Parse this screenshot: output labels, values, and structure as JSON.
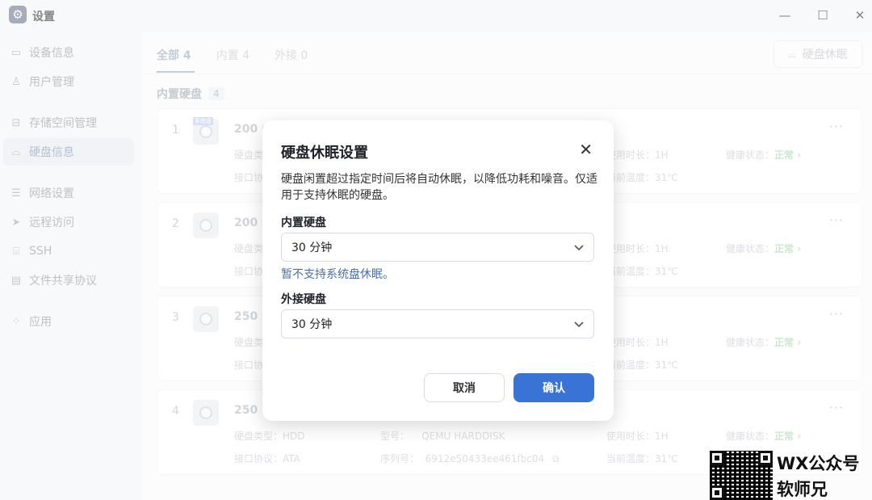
{
  "window": {
    "title": "设置",
    "minimize_glyph": "—",
    "maximize_glyph": "☐",
    "close_glyph": "✕"
  },
  "sidebar": {
    "items": [
      {
        "label": "设备信息",
        "icon": "device-icon",
        "active": false
      },
      {
        "label": "用户管理",
        "icon": "user-icon",
        "active": false
      },
      {
        "label": "存储空间管理",
        "icon": "storage-icon",
        "active": false
      },
      {
        "label": "硬盘信息",
        "icon": "disk-icon",
        "active": true
      },
      {
        "label": "网络设置",
        "icon": "network-icon",
        "active": false
      },
      {
        "label": "远程访问",
        "icon": "remote-icon",
        "active": false
      },
      {
        "label": "SSH",
        "icon": "ssh-icon",
        "active": false
      },
      {
        "label": "文件共享协议",
        "icon": "file-share-icon",
        "active": false
      },
      {
        "label": "应用",
        "icon": "apps-icon",
        "active": false
      }
    ]
  },
  "main": {
    "tabs": [
      {
        "label": "全部 4",
        "active": true
      },
      {
        "label": "内置 4",
        "active": false
      },
      {
        "label": "外接 0",
        "active": false
      }
    ],
    "sleep_button": "硬盘休眠",
    "section_title": "内置硬盘",
    "section_count": "4",
    "disks": [
      {
        "index": "1",
        "capacity": "200 G",
        "type_label": "硬盘类",
        "iface_label": "接口协",
        "use_time": "使用时长：1H",
        "temp": "当前温度：31℃",
        "health_label": "健康状态：",
        "health_value": "正常",
        "tag": "系统盘"
      },
      {
        "index": "2",
        "capacity": "200 G",
        "type_label": "硬盘类",
        "iface_label": "接口协",
        "use_time": "使用时长：1H",
        "temp": "当前温度：31℃",
        "health_label": "健康状态：",
        "health_value": "正常"
      },
      {
        "index": "3",
        "capacity": "250 G",
        "type_label": "硬盘类",
        "iface_label": "接口协",
        "use_time": "使用时长：1H",
        "temp": "当前温度：31℃",
        "health_label": "健康状态：",
        "health_value": "正常"
      },
      {
        "index": "4",
        "capacity": "250 G",
        "type_label": "硬盘类型：HDD",
        "iface_label": "接口协议：ATA",
        "model": "型号：",
        "model_value": "QEMU HARDDISK",
        "serial": "序列号：",
        "serial_value": "6912e50433ee461fbc04",
        "use_time": "使用时长：1H",
        "temp": "当前温度：31℃",
        "health_label": "健康状态：",
        "health_value": "正常"
      }
    ]
  },
  "dialog": {
    "title": "硬盘休眠设置",
    "description": "硬盘闲置超过指定时间后将自动休眠，以降低功耗和噪音。仅适用于支持休眠的硬盘。",
    "internal_label": "内置硬盘",
    "internal_value": "30 分钟",
    "internal_hint": "暂不支持系统盘休眠。",
    "external_label": "外接硬盘",
    "external_value": "30 分钟",
    "cancel": "取消",
    "confirm": "确认"
  },
  "watermark": {
    "line1": "WX公众号",
    "line2": "软师兄"
  },
  "colors": {
    "accent": "#3a73d6",
    "hint": "#4c6ea8",
    "health_ok": "#52c41a"
  }
}
